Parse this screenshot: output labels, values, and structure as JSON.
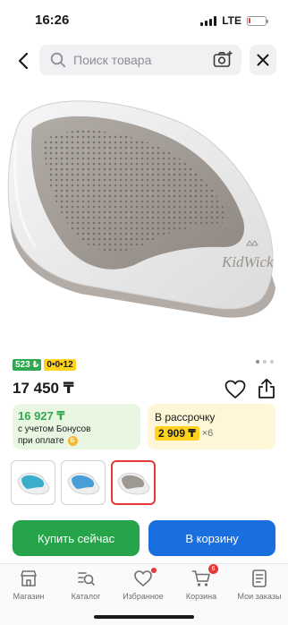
{
  "status_bar": {
    "time": "16:26",
    "network": "LTE",
    "battery_level": 0.12
  },
  "search": {
    "placeholder": "Поиск товара"
  },
  "product": {
    "brand_logo": "KidWick",
    "badges": {
      "rating": "523 ₺",
      "installment": "0•0•12"
    },
    "price": "17 450 ₸",
    "bonus_card": {
      "price": "16 927 ₸",
      "line1": "с учетом Бонусов",
      "line2": "при оплате"
    },
    "installment_card": {
      "title": "В рассрочку",
      "monthly": "2 909 ₸",
      "multiplier": "×6"
    },
    "thumbnails": [
      {
        "color": "#3aaecb",
        "selected": false
      },
      {
        "color": "#4a9ed6",
        "selected": false
      },
      {
        "color": "#9e9892",
        "selected": true
      }
    ],
    "gallery": {
      "slides": 3,
      "active": 1
    }
  },
  "actions": {
    "buy_now": "Купить сейчас",
    "add_to_cart": "В корзину"
  },
  "tabbar": {
    "items": [
      {
        "label": "Магазин",
        "icon": "shop-icon"
      },
      {
        "label": "Каталог",
        "icon": "catalog-icon"
      },
      {
        "label": "Избранное",
        "icon": "heart-icon"
      },
      {
        "label": "Корзина",
        "icon": "cart-icon",
        "badge": "6"
      },
      {
        "label": "Мои заказы",
        "icon": "orders-icon"
      }
    ]
  },
  "colors": {
    "green": "#25a44a",
    "blue": "#1a6fe0",
    "yellow": "#ffd21e",
    "red": "#e53935"
  }
}
